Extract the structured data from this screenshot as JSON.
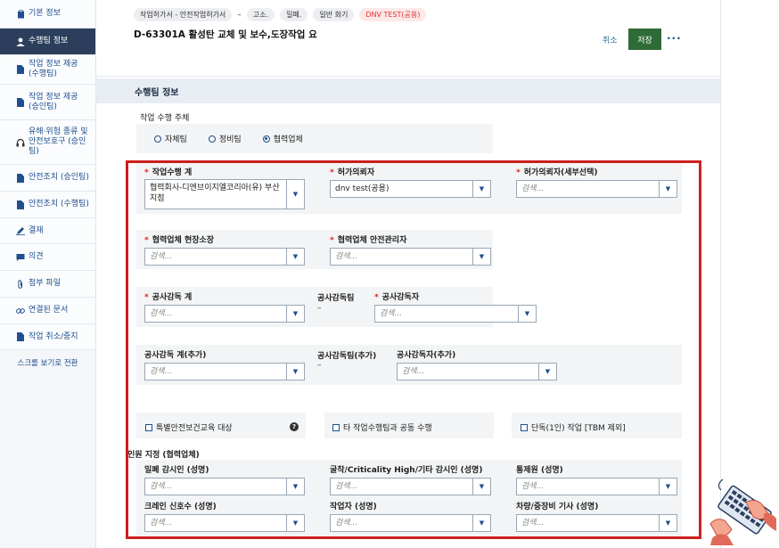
{
  "sidebar": {
    "items": [
      {
        "label": "기본 정보",
        "icon": "clipboard-icon"
      },
      {
        "label": "수행팀 정보",
        "icon": "person-icon"
      },
      {
        "label": "작업 정보 제공 (수행팀)",
        "icon": "document-icon"
      },
      {
        "label": "작업 정보 제공 (승인팀)",
        "icon": "document-icon"
      },
      {
        "label": "유해·위험 종류 및 안전보호구 (승인팀)",
        "icon": "headset-icon"
      },
      {
        "label": "안전조치 (승인팀)",
        "icon": "document-icon"
      },
      {
        "label": "안전조치 (수행팀)",
        "icon": "document-icon"
      },
      {
        "label": "결재",
        "icon": "pen-icon"
      },
      {
        "label": "의견",
        "icon": "comment-icon"
      },
      {
        "label": "첨부 파일",
        "icon": "paperclip-icon"
      },
      {
        "label": "연결된 문서",
        "icon": "link-icon"
      },
      {
        "label": "작업 취소/중지",
        "icon": "document-icon"
      }
    ],
    "scroll_view": "스크롤 보기로 전환"
  },
  "header": {
    "tags": [
      "작업허가서 - 안전작업허가서",
      "고소.",
      "밀폐.",
      "일반 화기"
    ],
    "separator": "–",
    "warn_tag": "DNV TEST(공용)",
    "title": "D-63301A 활성탄 교체 및 보수,도장작업 요",
    "cancel": "취소",
    "save": "저장",
    "more": "···"
  },
  "section": {
    "title": "수행팀 정보",
    "work_subject_label": "작업 수행 주체",
    "radios": [
      "자체팀",
      "정비팀",
      "협력업체"
    ],
    "selected_radio": "협력업체"
  },
  "form": {
    "f1": {
      "label": "작업수행 계",
      "value": "협력회사-디엔브이지엘코리아(유) 부산지점"
    },
    "f2": {
      "label": "허가의뢰자",
      "value": "dnv test(공용)"
    },
    "f3": {
      "label": "허가의뢰자(세부선택)",
      "placeholder": "검색..."
    },
    "f4": {
      "label": "협력업체 현장소장",
      "placeholder": "검색..."
    },
    "f5": {
      "label": "협력업체 안전관리자",
      "placeholder": "검색..."
    },
    "f6": {
      "label": "공사감독 계",
      "placeholder": "검색..."
    },
    "f7": {
      "label": "공사감독팀",
      "value": "–"
    },
    "f8": {
      "label": "공사감독자",
      "placeholder": "검색..."
    },
    "f9": {
      "label": "공사감독 계(추가)",
      "placeholder": "검색..."
    },
    "f10": {
      "label": "공사감독팀(추가)",
      "value": "–"
    },
    "f11": {
      "label": "공사감독자(추가)",
      "placeholder": "검색..."
    },
    "chk1": "특별안전보건교육 대상",
    "chk2": "타 작업수행팀과 공동 수행",
    "chk3": "단독(1인) 작업 [TBM 제외]",
    "personnel_label": "인원 지정 (협력업체)",
    "p1": {
      "label": "밀폐 감시인 (성명)",
      "placeholder": "검색..."
    },
    "p2": {
      "label": "굴착/Criticality High/기타 감시인 (성명)",
      "placeholder": "검색..."
    },
    "p3": {
      "label": "통제원 (성명)",
      "placeholder": "검색..."
    },
    "p4": {
      "label": "크레인 신호수 (성명)",
      "placeholder": "검색..."
    },
    "p5": {
      "label": "작업자 (성명)",
      "placeholder": "검색..."
    },
    "p6": {
      "label": "차량/중장비 기사 (성명)",
      "placeholder": "검색..."
    },
    "help": "?"
  },
  "colors": {
    "accent": "#1f4f8f",
    "save": "#2e6b37",
    "highlight": "#cc1f1f",
    "active_nav": "#2b3f5c"
  }
}
